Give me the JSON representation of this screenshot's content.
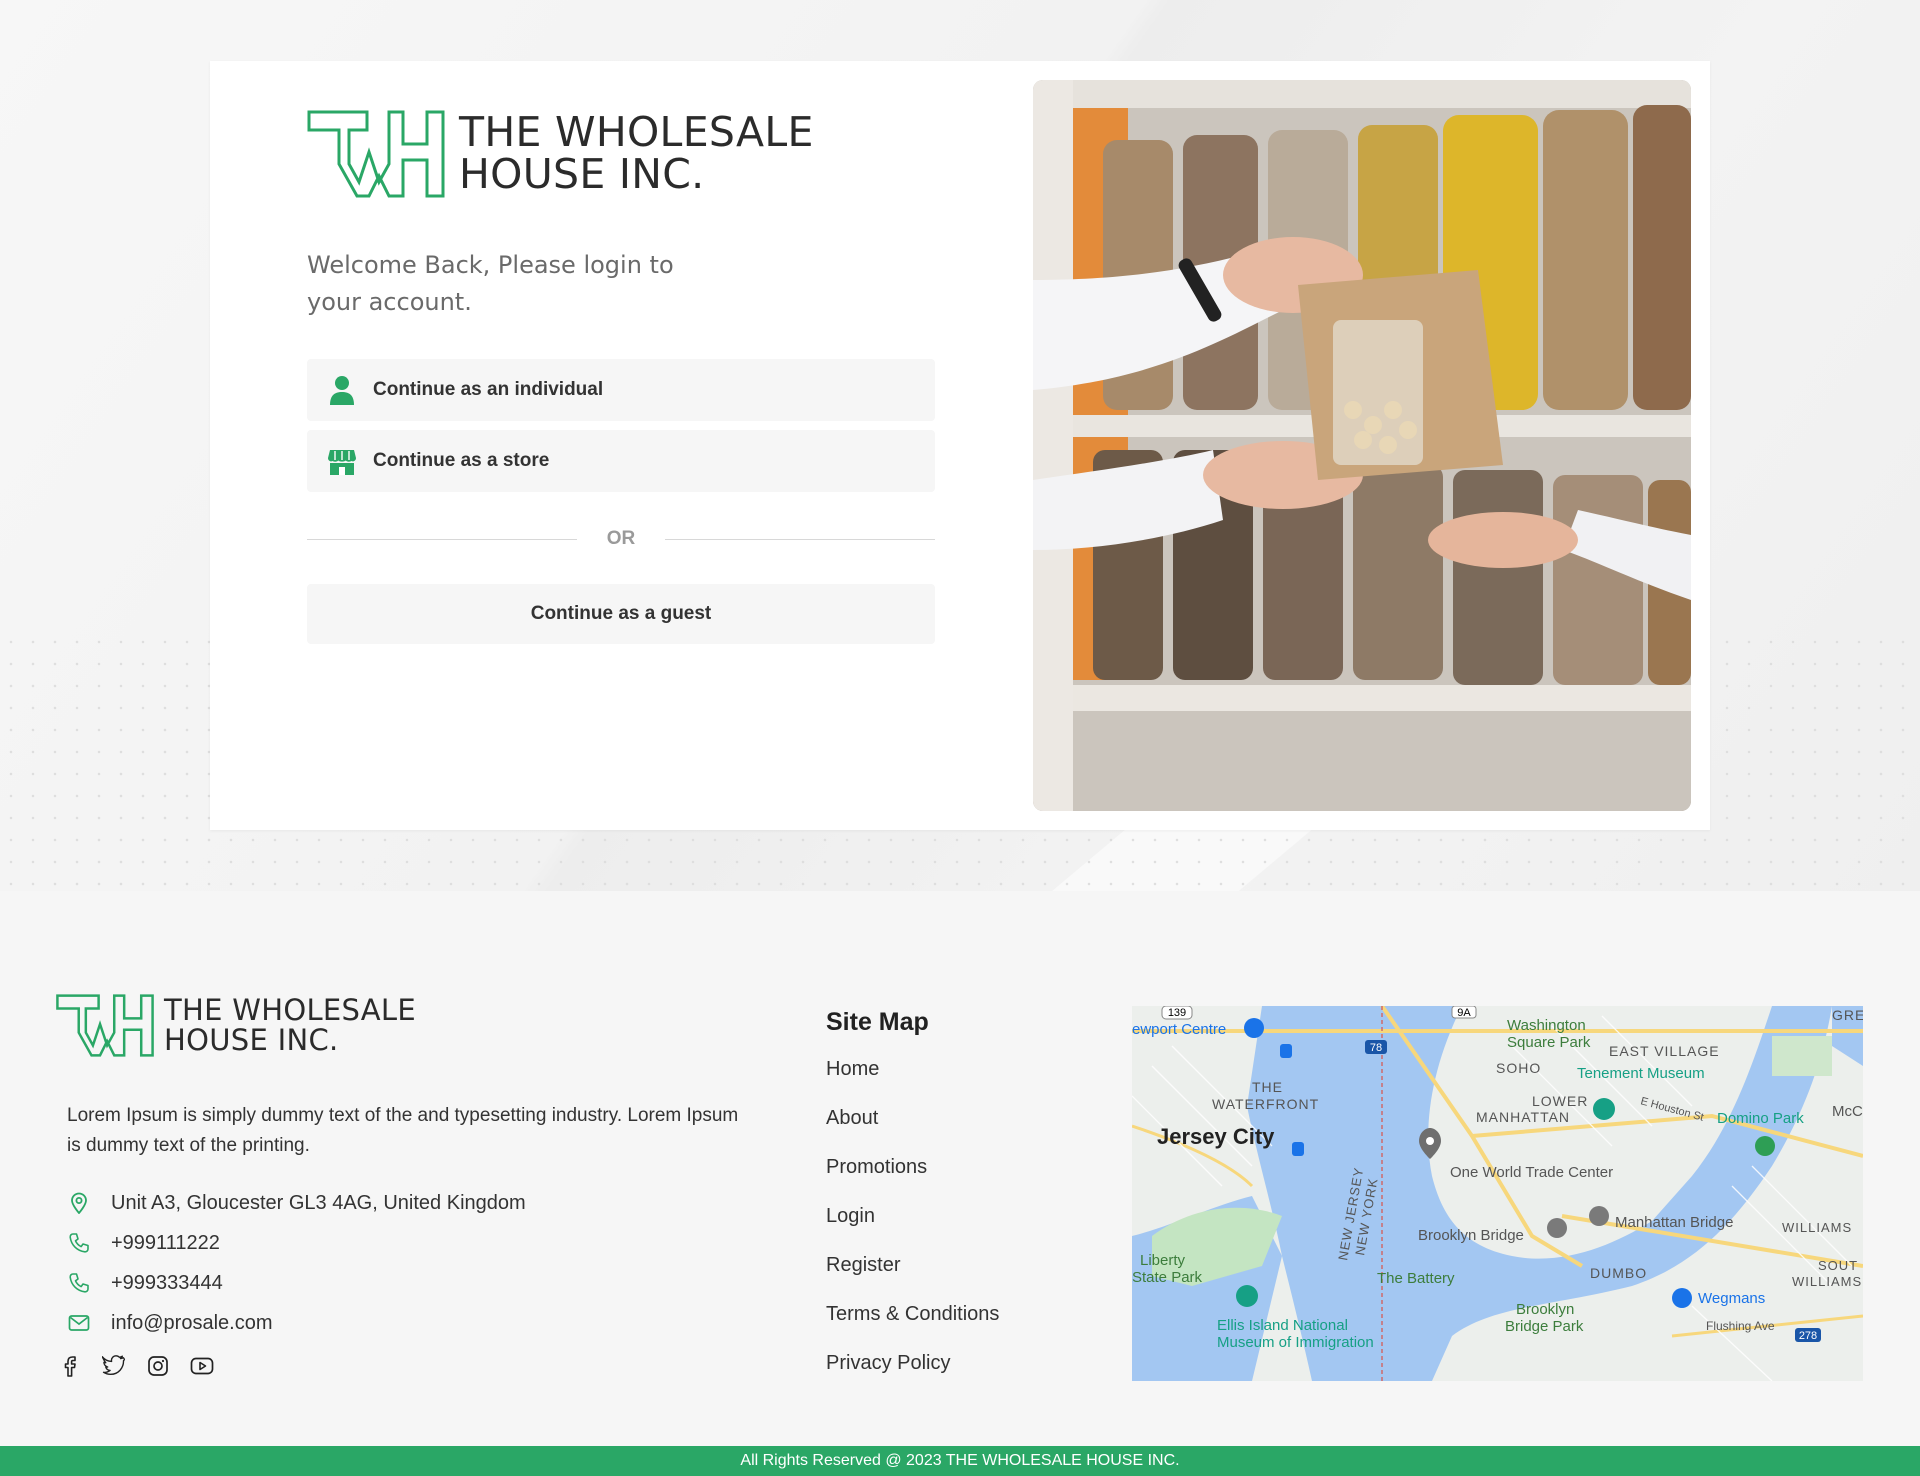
{
  "brand": {
    "name_line1": "THE WHOLESALE",
    "name_line2": "HOUSE INC.",
    "accent_color": "#2aa766"
  },
  "login": {
    "welcome": "Welcome Back, Please login to your account.",
    "individual_label": "Continue as an individual",
    "individual_icon": "user-icon",
    "store_label": "Continue as a store",
    "store_icon": "store-icon",
    "or_label": "OR",
    "guest_label": "Continue as a guest"
  },
  "footer": {
    "description": "Lorem Ipsum is simply dummy text of the and typesetting industry. Lorem Ipsum is dummy text of the printing.",
    "address": "Unit A3, Gloucester GL3 4AG, United Kingdom",
    "phone1": "+999111222",
    "phone2": "+999333444",
    "email": "info@prosale.com",
    "social_icons": [
      "facebook-icon",
      "twitter-icon",
      "instagram-icon",
      "youtube-icon"
    ],
    "sitemap_title": "Site Map",
    "sitemap": [
      "Home",
      "About",
      "Promotions",
      "Login",
      "Register",
      "Terms & Conditions",
      "Privacy Policy"
    ],
    "copyright": "All Rights Reserved @ 2023 THE WHOLESALE HOUSE INC."
  },
  "map": {
    "labels": {
      "newport": "ewport Centre",
      "washington": "Washington",
      "square_park": "Square Park",
      "east_village": "EAST VILLAGE",
      "soho": "SOHO",
      "tenement": "Tenement Museum",
      "the": "THE",
      "waterfront": "WATERFRONT",
      "lower": "LOWER",
      "manhattan": "MANHATTAN",
      "domino": "Domino Park",
      "jersey_city": "Jersey City",
      "one_wtc": "One World Trade Center",
      "new_jersey": "NEW JERSEY",
      "new_york": "NEW YORK",
      "brooklyn_bridge": "Brooklyn Bridge",
      "manhattan_bridge": "Manhattan Bridge",
      "williams": "WILLIAMS",
      "liberty1": "Liberty",
      "liberty2": "State Park",
      "the_battery": "The Battery",
      "dumbo": "DUMBO",
      "wegmans": "Wegmans",
      "ellis1": "Ellis Island National",
      "ellis2": "Museum of Immigration",
      "bbpark1": "Brooklyn",
      "bbpark2": "Bridge Park",
      "flushing": "Flushing Ave",
      "gre": "GRE",
      "mcca": "McCa",
      "sout": "SOUT",
      "williams2": "WILLIAMS",
      "e_houston": "E Houston St",
      "r139": "139",
      "r78": "78",
      "r9a": "9A",
      "r278": "278"
    }
  }
}
